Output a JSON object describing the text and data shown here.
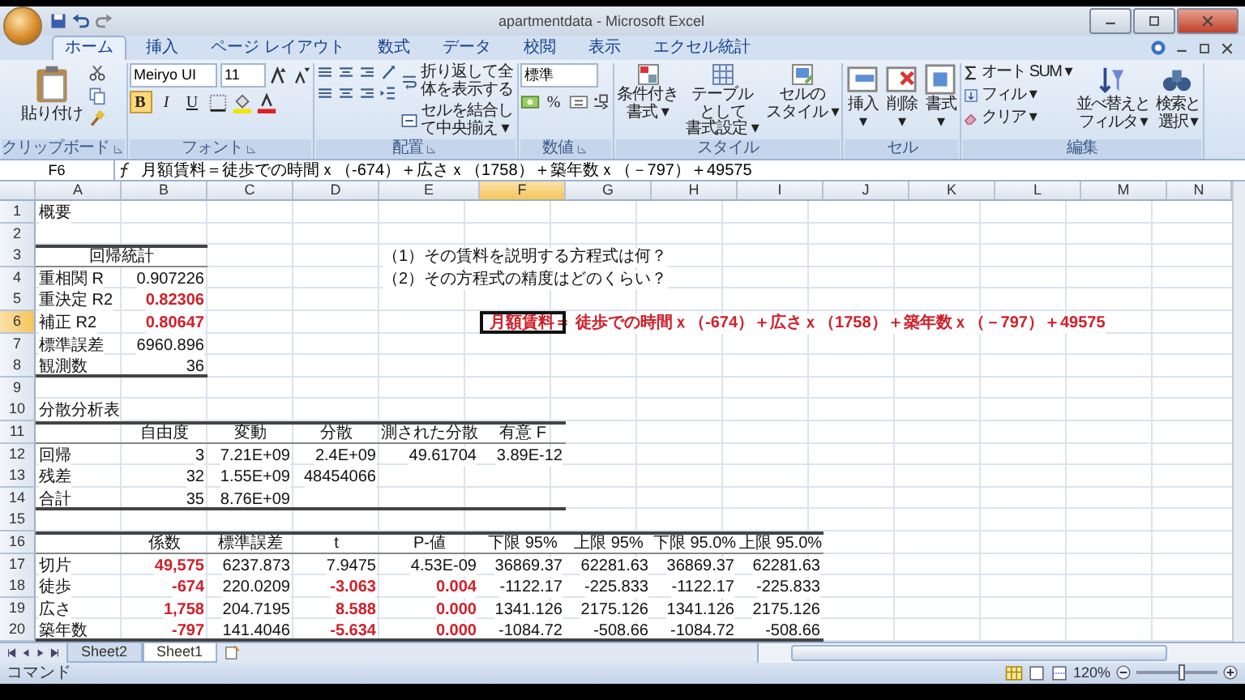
{
  "window": {
    "title": "apartmentdata - Microsoft Excel"
  },
  "ribbon": {
    "tabs": [
      {
        "label": "ホーム",
        "selected": true
      },
      {
        "label": "挿入",
        "selected": false
      },
      {
        "label": "ページ レイアウト",
        "selected": false
      },
      {
        "label": "数式",
        "selected": false
      },
      {
        "label": "データ",
        "selected": false
      },
      {
        "label": "校閲",
        "selected": false
      },
      {
        "label": "表示",
        "selected": false
      },
      {
        "label": "エクセル統計",
        "selected": false
      }
    ],
    "groups": [
      {
        "kind": "clipboard",
        "label": "クリップボード",
        "paste": "貼り付け"
      },
      {
        "kind": "font",
        "label": "フォント",
        "font_name": "Meiryo UI",
        "font_size": "11",
        "toggles": [
          {
            "label": "B",
            "selected": true
          },
          {
            "label": "I",
            "selected": false
          },
          {
            "label": "U",
            "selected": false
          }
        ]
      },
      {
        "kind": "alignment",
        "label": "配置",
        "actions": [
          "折り返して全体を表示する",
          "セルを結合して中央揃え ▾"
        ]
      },
      {
        "kind": "number",
        "label": "数値",
        "format": "標準",
        "percent": "%"
      },
      {
        "kind": "styles",
        "label": "スタイル",
        "buttons": [
          {
            "lines": [
              "条件付き",
              "書式 ▾"
            ]
          },
          {
            "lines": [
              "テーブルとして",
              "書式設定 ▾"
            ]
          },
          {
            "lines": [
              "セルの",
              "スタイル ▾"
            ]
          }
        ]
      },
      {
        "kind": "cells",
        "label": "セル",
        "buttons": [
          {
            "lines": [
              "挿入",
              "▾"
            ]
          },
          {
            "lines": [
              "削除",
              "▾"
            ]
          },
          {
            "lines": [
              "書式",
              "▾"
            ]
          }
        ]
      },
      {
        "kind": "editing",
        "label": "編集",
        "actions": [
          "オート SUM ▾",
          "フィル ▾",
          "クリア ▾"
        ],
        "buttons": [
          {
            "lines": [
              "並べ替えと",
              "フィルタ ▾"
            ]
          },
          {
            "lines": [
              "検索と",
              "選択 ▾"
            ]
          }
        ]
      }
    ]
  },
  "formula_bar": {
    "name_box": "F6",
    "formula": "月額賃料＝徒歩での時間ｘ（-674）＋広さｘ（1758）＋築年数ｘ（－797）＋49575"
  },
  "sheet": {
    "columns": [
      {
        "label": "A",
        "selected": false
      },
      {
        "label": "B",
        "selected": false
      },
      {
        "label": "C",
        "selected": false
      },
      {
        "label": "D",
        "selected": false
      },
      {
        "label": "E",
        "selected": false
      },
      {
        "label": "F",
        "selected": true
      },
      {
        "label": "G",
        "selected": false
      },
      {
        "label": "H",
        "selected": false
      },
      {
        "label": "I",
        "selected": false
      },
      {
        "label": "J",
        "selected": false
      },
      {
        "label": "K",
        "selected": false
      },
      {
        "label": "L",
        "selected": false
      },
      {
        "label": "M",
        "selected": false
      },
      {
        "label": "N",
        "selected": false
      }
    ],
    "rows": [
      {
        "label": "1",
        "selected": false,
        "cells": [
          {
            "text": "概要",
            "kind": "label"
          }
        ]
      },
      {
        "label": "2",
        "selected": false
      },
      {
        "label": "3",
        "selected": false,
        "cells": [
          {
            "text": "回帰統計",
            "kind": "caption",
            "border_top": true,
            "underline": true
          },
          {
            "kind": "blank"
          },
          {
            "kind": "blank"
          },
          {
            "text": "（1）その賃料を説明する方程式は何？",
            "kind": "label"
          }
        ]
      },
      {
        "label": "4",
        "selected": false,
        "cells": [
          {
            "text": "重相関 R",
            "kind": "label"
          },
          {
            "text": "0.907226",
            "kind": "number"
          },
          {
            "kind": "blank"
          },
          {
            "kind": "blank"
          },
          {
            "text": "（2）その方程式の精度はどのくらい？",
            "kind": "label"
          }
        ]
      },
      {
        "label": "5",
        "selected": false,
        "cells": [
          {
            "text": "重決定 R2",
            "kind": "label"
          },
          {
            "text": "0.82306",
            "kind": "key"
          }
        ]
      },
      {
        "label": "6",
        "selected": true,
        "cells": [
          {
            "text": "補正 R2",
            "kind": "label"
          },
          {
            "text": "0.80647",
            "kind": "key"
          },
          {
            "kind": "blank"
          },
          {
            "kind": "blank"
          },
          {
            "kind": "blank"
          },
          {
            "text": "月額賃料＝",
            "kind": "formula"
          },
          {
            "text": "徒歩での時間ｘ（-674）＋広さｘ（1758）＋築年数ｘ（－797）＋49575",
            "kind": "formula"
          }
        ]
      },
      {
        "label": "7",
        "selected": false,
        "cells": [
          {
            "text": "標準誤差",
            "kind": "label"
          },
          {
            "text": "6960.896",
            "kind": "number"
          }
        ]
      },
      {
        "label": "8",
        "selected": false,
        "cells": [
          {
            "text": "観測数",
            "kind": "label",
            "border_bottom": true
          },
          {
            "text": "36",
            "kind": "number",
            "border_bottom": true
          }
        ]
      },
      {
        "label": "9",
        "selected": false
      },
      {
        "label": "10",
        "selected": false,
        "cells": [
          {
            "text": "分散分析表",
            "kind": "label"
          }
        ]
      },
      {
        "label": "11",
        "selected": false,
        "cells": [
          {
            "kind": "blank",
            "border_top": true,
            "underline": true
          },
          {
            "text": "自由度",
            "kind": "header",
            "border_top": true,
            "underline": true
          },
          {
            "text": "変動",
            "kind": "header",
            "border_top": true,
            "underline": true
          },
          {
            "text": "分散",
            "kind": "header",
            "border_top": true,
            "underline": true
          },
          {
            "text": "測された分散",
            "kind": "header",
            "border_top": true,
            "underline": true
          },
          {
            "text": "有意 F",
            "kind": "header",
            "border_top": true,
            "underline": true
          }
        ]
      },
      {
        "label": "12",
        "selected": false,
        "cells": [
          {
            "text": "回帰",
            "kind": "label"
          },
          {
            "text": "3",
            "kind": "number"
          },
          {
            "text": "7.21E+09",
            "kind": "number"
          },
          {
            "text": "2.4E+09",
            "kind": "number"
          },
          {
            "text": "49.61704",
            "kind": "number"
          },
          {
            "text": "3.89E-12",
            "kind": "number"
          }
        ]
      },
      {
        "label": "13",
        "selected": false,
        "cells": [
          {
            "text": "残差",
            "kind": "label"
          },
          {
            "text": "32",
            "kind": "number"
          },
          {
            "text": "1.55E+09",
            "kind": "number"
          },
          {
            "text": "48454066",
            "kind": "number"
          }
        ]
      },
      {
        "label": "14",
        "selected": false,
        "cells": [
          {
            "text": "合計",
            "kind": "label",
            "border_bottom": true
          },
          {
            "text": "35",
            "kind": "number",
            "border_bottom": true
          },
          {
            "text": "8.76E+09",
            "kind": "number",
            "border_bottom": true
          },
          {
            "kind": "blank",
            "border_bottom": true
          },
          {
            "kind": "blank",
            "border_bottom": true
          },
          {
            "kind": "blank",
            "border_bottom": true
          }
        ]
      },
      {
        "label": "15",
        "selected": false
      },
      {
        "label": "16",
        "selected": false,
        "cells": [
          {
            "kind": "blank",
            "border_top": true,
            "underline": true
          },
          {
            "text": "係数",
            "kind": "header",
            "border_top": true,
            "underline": true
          },
          {
            "text": "標準誤差",
            "kind": "header",
            "border_top": true,
            "underline": true
          },
          {
            "text": "t",
            "kind": "header",
            "border_top": true,
            "underline": true
          },
          {
            "text": "P-値",
            "kind": "header",
            "border_top": true,
            "underline": true
          },
          {
            "text": "下限 95%",
            "kind": "header",
            "border_top": true,
            "underline": true
          },
          {
            "text": "上限 95%",
            "kind": "header",
            "border_top": true,
            "underline": true
          },
          {
            "text": "下限 95.0%",
            "kind": "header",
            "border_top": true,
            "underline": true
          },
          {
            "text": "上限 95.0%",
            "kind": "header",
            "border_top": true,
            "underline": true
          }
        ]
      },
      {
        "label": "17",
        "selected": false,
        "cells": [
          {
            "text": "切片",
            "kind": "label"
          },
          {
            "text": "49,575",
            "kind": "key"
          },
          {
            "text": "6237.873",
            "kind": "number"
          },
          {
            "text": "7.9475",
            "kind": "number"
          },
          {
            "text": "4.53E-09",
            "kind": "number"
          },
          {
            "text": "36869.37",
            "kind": "number"
          },
          {
            "text": "62281.63",
            "kind": "number"
          },
          {
            "text": "36869.37",
            "kind": "number"
          },
          {
            "text": "62281.63",
            "kind": "number"
          }
        ]
      },
      {
        "label": "18",
        "selected": false,
        "cells": [
          {
            "text": "徒歩",
            "kind": "label"
          },
          {
            "text": "-674",
            "kind": "key"
          },
          {
            "text": "220.0209",
            "kind": "number"
          },
          {
            "text": "-3.063",
            "kind": "key"
          },
          {
            "text": "0.004",
            "kind": "key"
          },
          {
            "text": "-1122.17",
            "kind": "number"
          },
          {
            "text": "-225.833",
            "kind": "number"
          },
          {
            "text": "-1122.17",
            "kind": "number"
          },
          {
            "text": "-225.833",
            "kind": "number"
          }
        ]
      },
      {
        "label": "19",
        "selected": false,
        "cells": [
          {
            "text": "広さ",
            "kind": "label"
          },
          {
            "text": "1,758",
            "kind": "key"
          },
          {
            "text": "204.7195",
            "kind": "number"
          },
          {
            "text": "8.588",
            "kind": "key"
          },
          {
            "text": "0.000",
            "kind": "key"
          },
          {
            "text": "1341.126",
            "kind": "number"
          },
          {
            "text": "2175.126",
            "kind": "number"
          },
          {
            "text": "1341.126",
            "kind": "number"
          },
          {
            "text": "2175.126",
            "kind": "number"
          }
        ]
      },
      {
        "label": "20",
        "selected": false,
        "cells": [
          {
            "text": "築年数",
            "kind": "label",
            "border_bottom": true
          },
          {
            "text": "-797",
            "kind": "key",
            "border_bottom": true
          },
          {
            "text": "141.4046",
            "kind": "number",
            "border_bottom": true
          },
          {
            "text": "-5.634",
            "kind": "key",
            "border_bottom": true
          },
          {
            "text": "0.000",
            "kind": "key",
            "border_bottom": true
          },
          {
            "text": "-1084.72",
            "kind": "number",
            "border_bottom": true
          },
          {
            "text": "-508.66",
            "kind": "number",
            "border_bottom": true
          },
          {
            "text": "-1084.72",
            "kind": "number",
            "border_bottom": true
          },
          {
            "text": "-508.66",
            "kind": "number",
            "border_bottom": true
          }
        ]
      }
    ]
  },
  "sheet_tabs": [
    {
      "label": "Sheet2",
      "selected": false
    },
    {
      "label": "Sheet1",
      "selected": true
    }
  ],
  "status_bar": {
    "mode": "コマンド",
    "zoom": "120%",
    "zoom_slider": {
      "level": 0.55
    }
  }
}
